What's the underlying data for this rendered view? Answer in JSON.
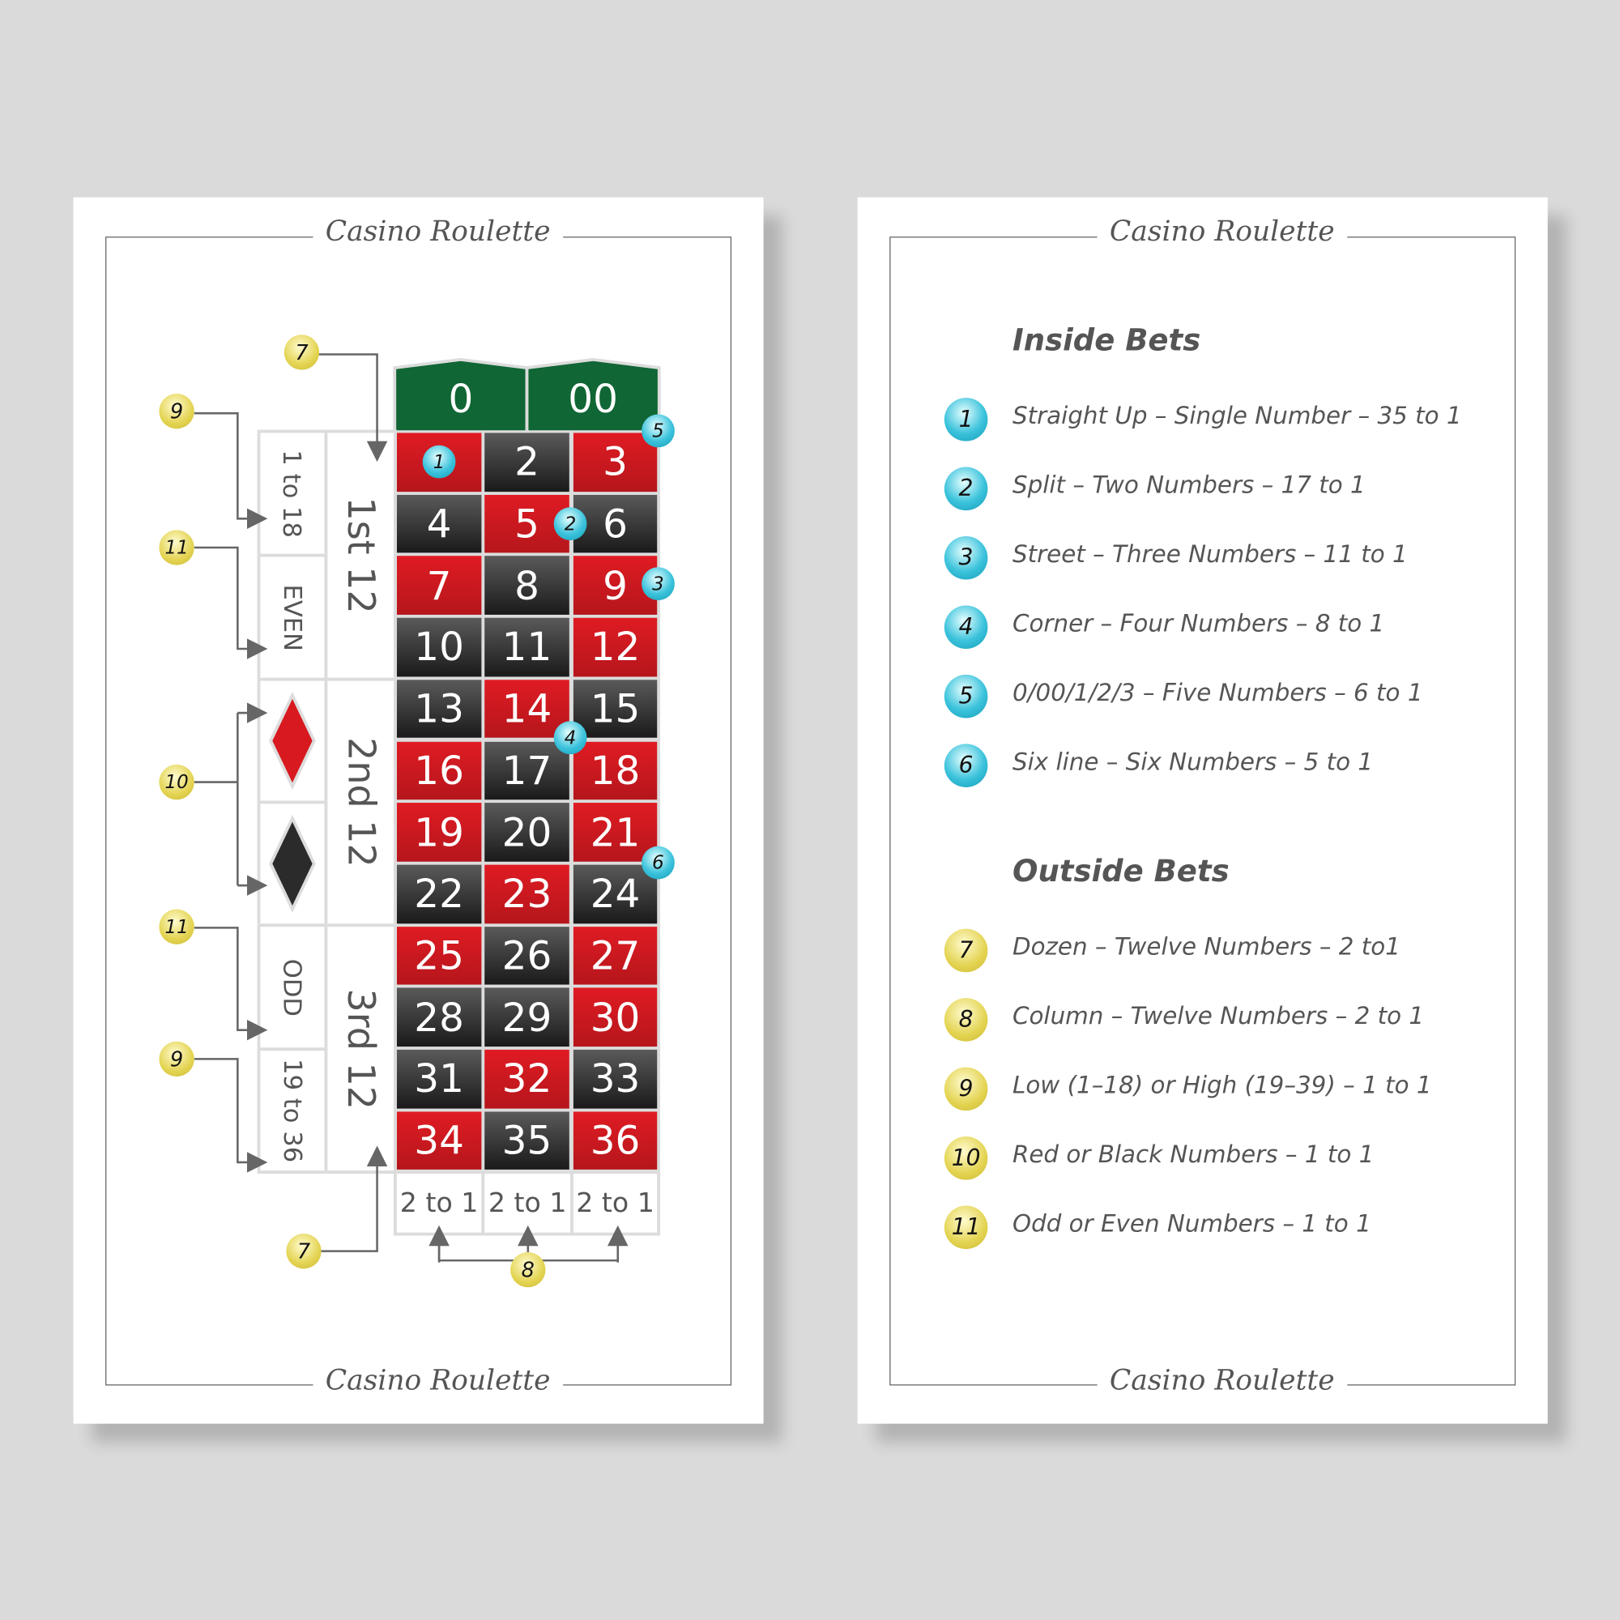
{
  "brand_title": "Casino Roulette",
  "table": {
    "zero": "0",
    "double_zero": "00",
    "rows": [
      [
        {
          "n": "1",
          "c": "red"
        },
        {
          "n": "2",
          "c": "black"
        },
        {
          "n": "3",
          "c": "red"
        }
      ],
      [
        {
          "n": "4",
          "c": "black"
        },
        {
          "n": "5",
          "c": "red"
        },
        {
          "n": "6",
          "c": "black"
        }
      ],
      [
        {
          "n": "7",
          "c": "red"
        },
        {
          "n": "8",
          "c": "black"
        },
        {
          "n": "9",
          "c": "red"
        }
      ],
      [
        {
          "n": "10",
          "c": "black"
        },
        {
          "n": "11",
          "c": "black"
        },
        {
          "n": "12",
          "c": "red"
        }
      ],
      [
        {
          "n": "13",
          "c": "black"
        },
        {
          "n": "14",
          "c": "red"
        },
        {
          "n": "15",
          "c": "black"
        }
      ],
      [
        {
          "n": "16",
          "c": "red"
        },
        {
          "n": "17",
          "c": "black"
        },
        {
          "n": "18",
          "c": "red"
        }
      ],
      [
        {
          "n": "19",
          "c": "red"
        },
        {
          "n": "20",
          "c": "black"
        },
        {
          "n": "21",
          "c": "red"
        }
      ],
      [
        {
          "n": "22",
          "c": "black"
        },
        {
          "n": "23",
          "c": "red"
        },
        {
          "n": "24",
          "c": "black"
        }
      ],
      [
        {
          "n": "25",
          "c": "red"
        },
        {
          "n": "26",
          "c": "black"
        },
        {
          "n": "27",
          "c": "red"
        }
      ],
      [
        {
          "n": "28",
          "c": "black"
        },
        {
          "n": "29",
          "c": "black"
        },
        {
          "n": "30",
          "c": "red"
        }
      ],
      [
        {
          "n": "31",
          "c": "black"
        },
        {
          "n": "32",
          "c": "red"
        },
        {
          "n": "33",
          "c": "black"
        }
      ],
      [
        {
          "n": "34",
          "c": "red"
        },
        {
          "n": "35",
          "c": "black"
        },
        {
          "n": "36",
          "c": "red"
        }
      ]
    ],
    "columns": [
      "2 to 1",
      "2 to 1",
      "2 to 1"
    ],
    "dozens": [
      "1st 12",
      "2nd 12",
      "3rd 12"
    ],
    "outside": [
      "1 to 18",
      "EVEN",
      "red-diamond",
      "black-diamond",
      "ODD",
      "19 to 36"
    ],
    "inside_markers": [
      "1",
      "2",
      "3",
      "4",
      "5",
      "6"
    ],
    "outside_markers": [
      "7",
      "9",
      "11",
      "10",
      "11",
      "9",
      "7",
      "8"
    ]
  },
  "inside_bets": {
    "title": "Inside Bets",
    "items": [
      {
        "num": "1",
        "text": "Straight Up – Single Number – 35 to 1"
      },
      {
        "num": "2",
        "text": "Split – Two Numbers – 17 to 1"
      },
      {
        "num": "3",
        "text": "Street – Three Numbers – 11 to 1"
      },
      {
        "num": "4",
        "text": "Corner – Four Numbers – 8 to 1"
      },
      {
        "num": "5",
        "text": "0/00/1/2/3 – Five Numbers – 6 to 1"
      },
      {
        "num": "6",
        "text": "Six line – Six Numbers – 5 to 1"
      }
    ]
  },
  "outside_bets": {
    "title": "Outside Bets",
    "items": [
      {
        "num": "7",
        "text": "Dozen – Twelve Numbers – 2 to1"
      },
      {
        "num": "8",
        "text": "Column – Twelve Numbers – 2 to 1"
      },
      {
        "num": "9",
        "text": "Low (1–18) or High (19–39) – 1 to 1"
      },
      {
        "num": "10",
        "text": "Red or Black Numbers – 1 to 1"
      },
      {
        "num": "11",
        "text": "Odd or Even Numbers – 1 to 1"
      }
    ]
  },
  "colors": {
    "red": "#d81920",
    "black": "#2b2b2b",
    "green": "#106634",
    "yellow_marker": "#e3d350",
    "blue_marker": "#3cc3dc"
  }
}
